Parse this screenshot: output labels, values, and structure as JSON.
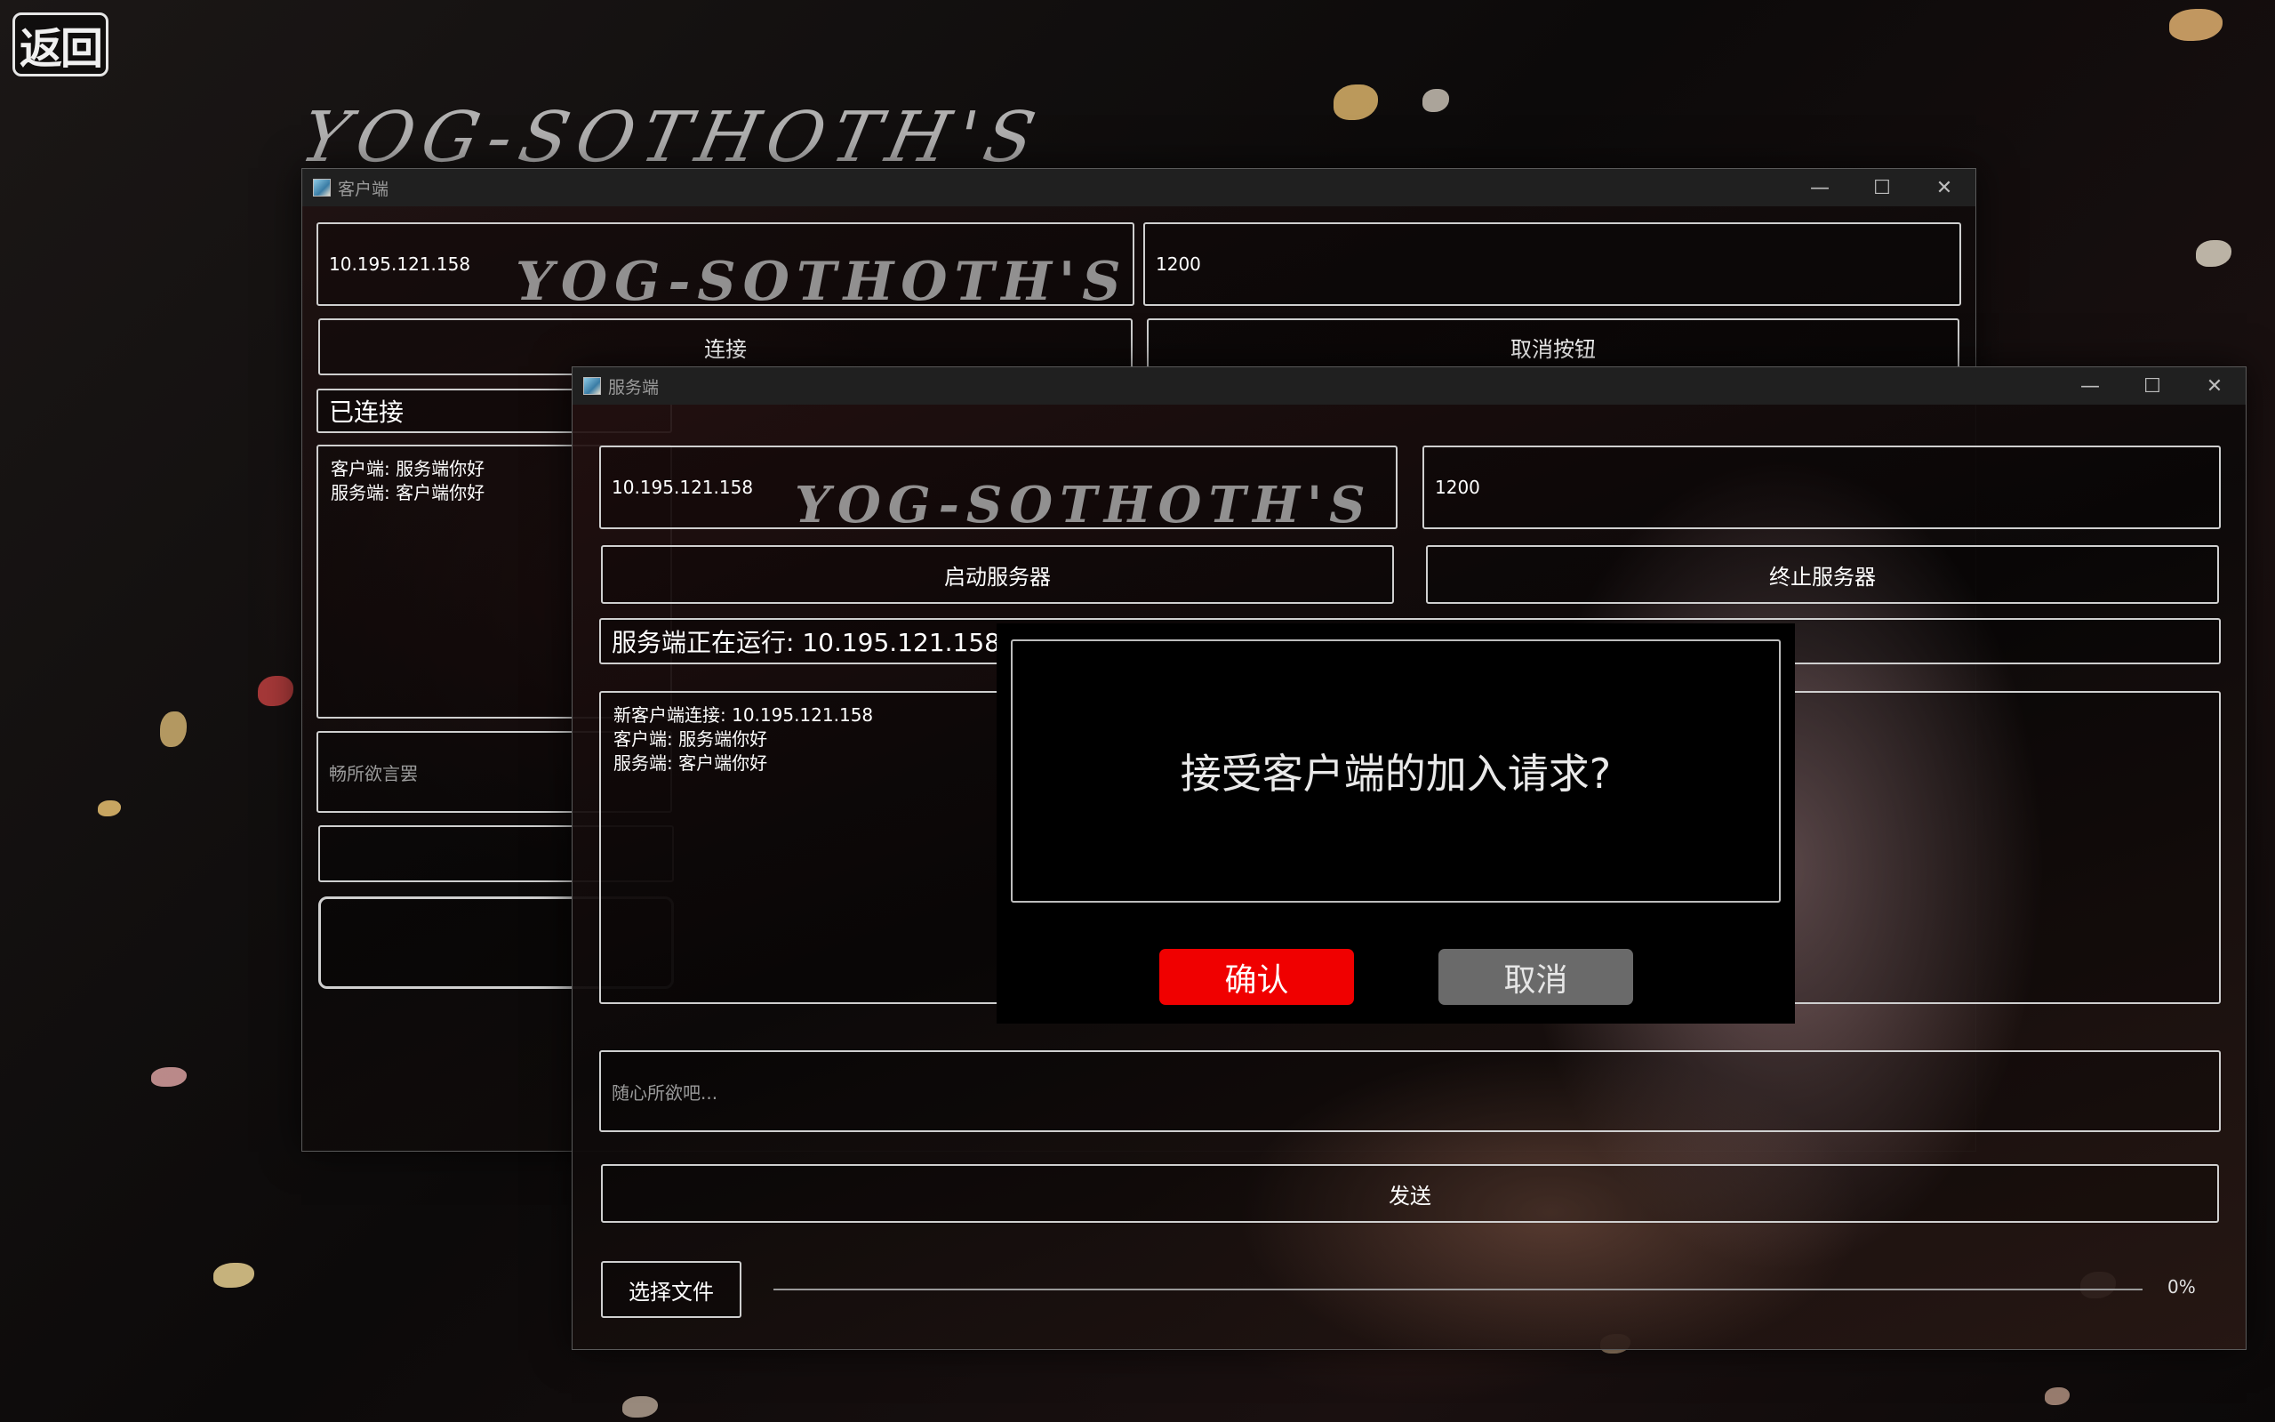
{
  "app": {
    "back_label": "返回",
    "bg_title": "YOG-SOTHOTH'S"
  },
  "client_window": {
    "title": "客户端",
    "ip_value": "10.195.121.158",
    "port_value": "1200",
    "connect_label": "连接",
    "cancel_label": "取消按钮",
    "status_text": "已连接",
    "log_lines": [
      "客户端: 服务端你好",
      "服务端: 客户端你好"
    ],
    "input_placeholder": "畅所欲言罢"
  },
  "server_window": {
    "title": "服务端",
    "ip_value": "10.195.121.158",
    "port_value": "1200",
    "start_label": "启动服务器",
    "stop_label": "终止服务器",
    "status_text": "服务端正在运行: 10.195.121.158:12",
    "log_lines": [
      "新客户端连接: 10.195.121.158",
      "客户端: 服务端你好",
      "服务端: 客户端你好"
    ],
    "input_placeholder": "随心所欲吧...",
    "send_label": "发送",
    "choose_file_label": "选择文件",
    "progress_text": "0%",
    "progress_value": 0
  },
  "dialog": {
    "message": "接受客户端的加入请求?",
    "confirm_label": "确认",
    "cancel_label": "取消",
    "confirm_color": "#f00000",
    "cancel_color": "#6a6a6a"
  },
  "window_controls": {
    "minimize": "—",
    "maximize": "☐",
    "close": "✕"
  }
}
